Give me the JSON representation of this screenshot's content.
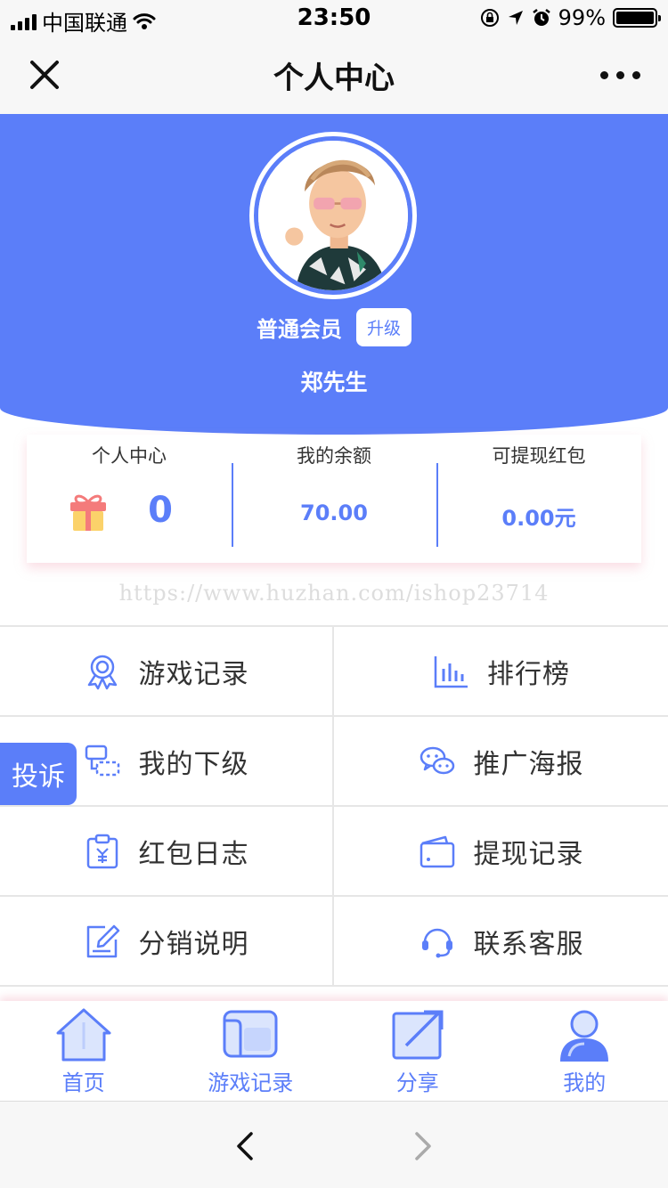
{
  "status_bar": {
    "carrier": "中国联通",
    "time": "23:50",
    "battery_percent": "99%",
    "battery_level": 0.99
  },
  "nav": {
    "title": "个人中心"
  },
  "profile": {
    "member_level": "普通会员",
    "upgrade_label": "升级",
    "username": "郑先生"
  },
  "stats": [
    {
      "label": "个人中心",
      "value": "0"
    },
    {
      "label": "我的余额",
      "value": "70.00"
    },
    {
      "label": "可提现红包",
      "value": "0.00元"
    }
  ],
  "watermark": "https://www.huzhan.com/ishop23714",
  "menu": [
    {
      "label": "游戏记录",
      "icon": "award-icon"
    },
    {
      "label": "排行榜",
      "icon": "bar-chart-icon"
    },
    {
      "label": "我的下级",
      "icon": "subordinate-icon"
    },
    {
      "label": "推广海报",
      "icon": "wechat-icon"
    },
    {
      "label": "红包日志",
      "icon": "red-packet-log-icon"
    },
    {
      "label": "提现记录",
      "icon": "wallet-icon"
    },
    {
      "label": "分销说明",
      "icon": "edit-icon"
    },
    {
      "label": "联系客服",
      "icon": "headset-icon"
    }
  ],
  "complaint_label": "投诉",
  "tabs": [
    {
      "label": "首页",
      "icon": "home-icon"
    },
    {
      "label": "游戏记录",
      "icon": "game-record-icon"
    },
    {
      "label": "分享",
      "icon": "share-icon"
    },
    {
      "label": "我的",
      "icon": "user-icon"
    }
  ],
  "colors": {
    "primary": "#5b7ef9",
    "text": "#333333",
    "divider": "#e6e6e6"
  }
}
